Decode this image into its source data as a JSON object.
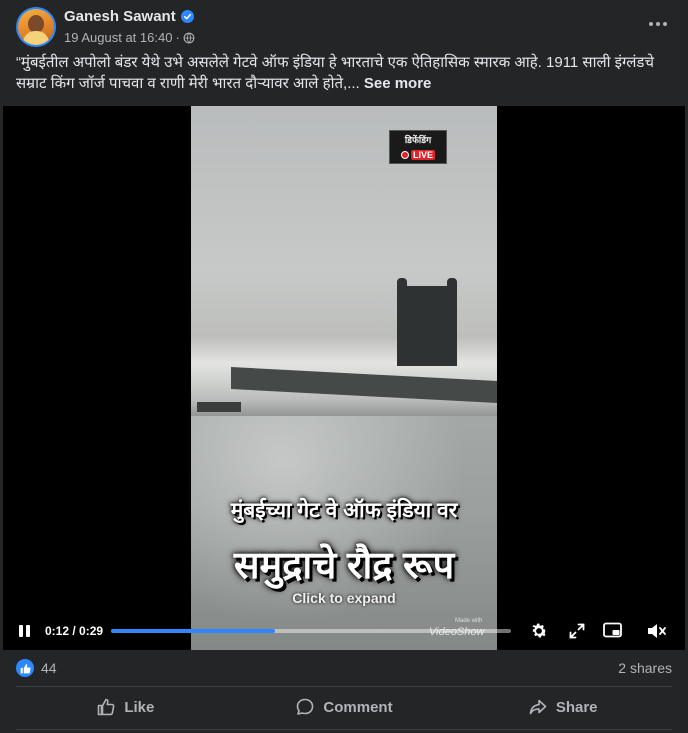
{
  "post": {
    "author": "Ganesh Sawant",
    "verified_icon": "verified-badge-icon",
    "timestamp": "19 August at 16:40",
    "separator": "·",
    "audience_icon": "globe-icon",
    "caption": "“मुंबईतील अपोलो बंडर येथे उभे असलेले गेटवे ऑफ इंडिया हे भारताचे एक ऐतिहासिक स्मारक आहे. 1911 साली इंग्लंडचे सम्राट किंग जॉर्ज पाचवा व राणी मेरी भारत दौऱ्यावर आले होते,... ",
    "see_more": "See more"
  },
  "video": {
    "badge_top": "डिफेंडिंग",
    "badge_live": "LIVE",
    "overlay_line1": "मुंबईच्या गेट वे ऑफ इंडिया वर",
    "overlay_line2": "समुद्राचे रौद्र रूप",
    "click_to_expand": "Click to expand",
    "time": "0:12 / 0:29",
    "progress": 0.41,
    "watermark_small": "Made with",
    "watermark": "VideoShow",
    "icons": [
      "pause-icon",
      "settings-icon",
      "expand-icon",
      "miniplayer-icon",
      "mute-icon"
    ]
  },
  "stats": {
    "reactions": "44",
    "shares": "2 shares"
  },
  "actions": {
    "like": "Like",
    "comment": "Comment",
    "share": "Share"
  },
  "colors": {
    "background": "#242526",
    "accent": "#2d88ff",
    "text_primary": "#e4e6eb",
    "text_secondary": "#b0b3b8"
  }
}
